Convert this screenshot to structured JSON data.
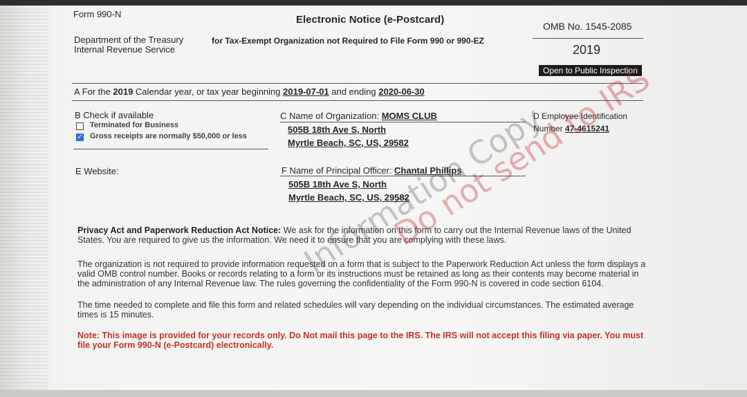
{
  "header": {
    "form_id": "Form 990-N",
    "title": "Electronic Notice (e-Postcard)",
    "subtitle": "for Tax-Exempt Organization not Required to File Form 990 or 990-EZ",
    "dept_line1": "Department of the Treasury",
    "dept_line2": "Internal Revenue Service",
    "omb": "OMB No. 1545-2085",
    "year": "2019",
    "public_badge": "Open to Public Inspection"
  },
  "section_a": {
    "prefix": "A For the",
    "year": "2019",
    "mid": "Calendar year, or tax year beginning",
    "begin": "2019-07-01",
    "and_ending": "and ending",
    "end": "2020-06-30"
  },
  "section_b": {
    "label": "B Check if available",
    "option1": "Terminated for Business",
    "option2": "Gross receipts are normally $50,000 or less",
    "option2_checked": "✓"
  },
  "section_c": {
    "label": "C Name of Organization:",
    "org_name": "MOMS CLUB",
    "address1": "505B 18th Ave S, North",
    "address2": "Myrtle Beach, SC, US, 29582"
  },
  "section_d": {
    "label": "D Employee Identification",
    "number_label": "Number",
    "ein": "47-4615241"
  },
  "section_e": {
    "label": "E Website:"
  },
  "section_f": {
    "label": "F Name of Principal Officer:",
    "officer": "Chantal Phillips",
    "address1": "505B 18th Ave S, North",
    "address2": "Myrtle Beach, SC, US, 29582"
  },
  "privacy": {
    "heading": "Privacy Act and Paperwork Reduction Act Notice:",
    "text1": "We ask for the information on this form to carry out the Internal Revenue laws of the United States. You are required to give us the information. We need it to ensure that you are complying with these laws.",
    "text2": "The organization is not required to provide information requested on a form that is subject to the Paperwork Reduction Act unless the form displays a valid OMB control number. Books or records relating to a form or its instructions must be retained as long as their contents may become material in the administration of any Internal Revenue law. The rules governing the confidentiality of the Form 990-N is covered in code section 6104.",
    "text3": "The time needed to complete and file this form and related schedules will vary depending on the individual circumstances. The estimated average times is 15 minutes.",
    "note": "Note: This image is provided for your records only. Do Not mail this page to the IRS. The IRS will not accept this filing via paper. You must file your Form 990-N (e-Postcard) electronically."
  },
  "watermark": {
    "line1": "Information Copy",
    "line2": "Do not send to IRS"
  }
}
